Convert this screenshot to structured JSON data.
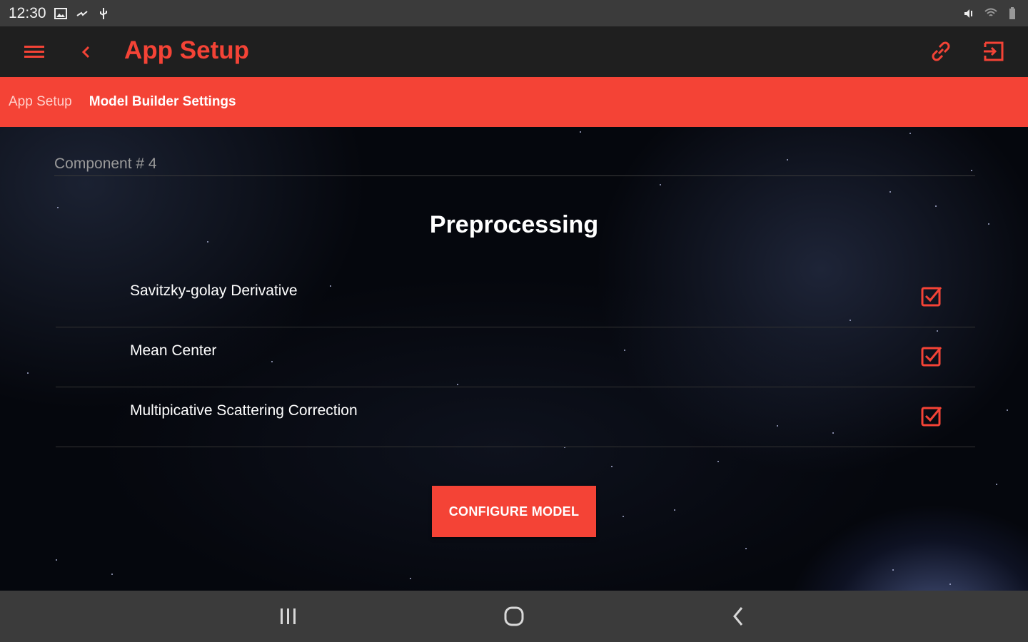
{
  "status_bar": {
    "time": "12:30",
    "icons": [
      "image-icon",
      "cast-icon",
      "usb-icon",
      "mute-icon",
      "wifi-icon",
      "battery-icon"
    ]
  },
  "app_bar": {
    "title": "App Setup",
    "icons": [
      "menu-icon",
      "back-icon",
      "link-icon",
      "logout-icon"
    ]
  },
  "breadcrumb": {
    "items": [
      {
        "label": "App Setup",
        "active": false
      },
      {
        "label": "Model Builder Settings",
        "active": true
      }
    ]
  },
  "main": {
    "component_label": "Component # 4",
    "section_title": "Preprocessing",
    "options": [
      {
        "label": "Savitzky-golay Derivative",
        "checked": true
      },
      {
        "label": "Mean Center",
        "checked": true
      },
      {
        "label": "Multipicative Scattering Correction",
        "checked": true
      }
    ],
    "configure_button": "CONFIGURE MODEL"
  },
  "nav_bar": {
    "icons": [
      "recents-icon",
      "home-icon",
      "back-icon"
    ]
  },
  "colors": {
    "accent": "#f44336",
    "app_bar_bg": "#1f1f1f",
    "system_bar_bg": "#3b3b3b"
  }
}
